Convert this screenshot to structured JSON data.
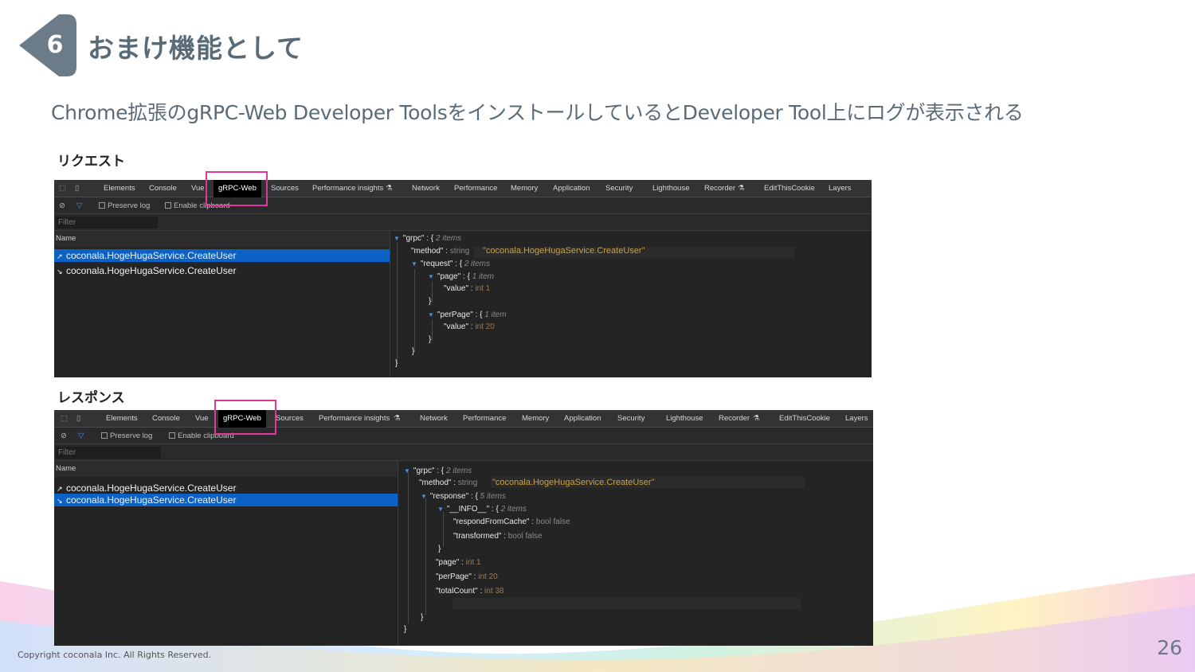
{
  "slide": {
    "number": "6",
    "title": "おまけ機能として",
    "subtitle": "Chrome拡張のgRPC-Web Developer ToolsをインストールしているとDeveloper Tool上にログが表示される",
    "footer": "Copyright coconala Inc. All Rights Reserved.",
    "page": "26",
    "badge_color": "#6b7b88",
    "highlight_color": "#e0389a"
  },
  "request": {
    "heading": "リクエスト",
    "tabs": [
      "Elements",
      "Console",
      "Vue",
      "gRPC-Web",
      "Sources",
      "Performance insights",
      "Network",
      "Performance",
      "Memory",
      "Application",
      "Security",
      "Lighthouse",
      "Recorder",
      "EditThisCookie",
      "Layers"
    ],
    "toolbar": {
      "preserve_log": "Preserve log",
      "enable_clipboard": "Enable clipboard",
      "filter_placeholder": "Filter"
    },
    "name_header": "Name",
    "rows": [
      "coconala.HogeHugaService.CreateUser",
      "coconala.HogeHugaService.CreateUser"
    ],
    "json": {
      "grpc_key": "\"grpc\" : {",
      "grpc_meta": "2 items",
      "method_key": "\"method\" :",
      "method_type": "string",
      "method_value": "\"coconala.HogeHugaService.CreateUser\"",
      "request_key": "\"request\" : {",
      "request_meta": "2 items",
      "page_key": "\"page\" : {",
      "page_meta": "1 item",
      "value_key": "\"value\" :",
      "value_type": "int",
      "page_value": "1",
      "close_brace": "}",
      "perpage_key": "\"perPage\" : {",
      "perpage_meta": "1 item",
      "perpage_value": "20"
    }
  },
  "response": {
    "heading": "レスポンス",
    "tabs": [
      "Elements",
      "Console",
      "Vue",
      "gRPC-Web",
      "Sources",
      "Performance insights",
      "Network",
      "Performance",
      "Memory",
      "Application",
      "Security",
      "Lighthouse",
      "Recorder",
      "EditThisCookie",
      "Layers"
    ],
    "toolbar": {
      "preserve_log": "Preserve log",
      "enable_clipboard": "Enable clipboard",
      "filter_placeholder": "Filter"
    },
    "name_header": "Name",
    "rows": [
      "coconala.HogeHugaService.CreateUser",
      "coconala.HogeHugaService.CreateUser"
    ],
    "json": {
      "grpc_key": "\"grpc\" : {",
      "grpc_meta": "2 items",
      "method_key": "\"method\" :",
      "method_type": "string",
      "method_value": "\"coconala.HogeHugaService.CreateUser\"",
      "response_key": "\"response\" : {",
      "response_meta": "5 items",
      "info_key": "\"__INFO__\" : {",
      "info_meta": "2 items",
      "respond_key": "\"respondFromCache\" :",
      "bool_type": "bool",
      "respond_value": "false",
      "transformed_key": "\"transformed\" :",
      "transformed_value": "false",
      "close_brace": "}",
      "page_key": "\"page\" :",
      "int_type": "int",
      "page_value": "1",
      "perpage_key": "\"perPage\" :",
      "perpage_value": "20",
      "total_key": "\"totalCount\" :",
      "total_value": "38"
    }
  }
}
